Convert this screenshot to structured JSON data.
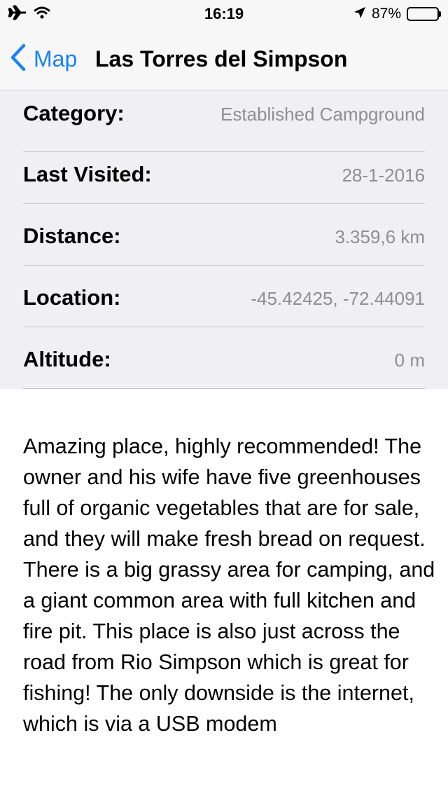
{
  "status_bar": {
    "time": "16:19",
    "battery_percent": "87%",
    "battery_level": 0.87,
    "icons": [
      "airplane-icon",
      "wifi-icon",
      "location-arrow-icon",
      "battery-icon"
    ]
  },
  "nav": {
    "back_label": "Map",
    "title": "Las Torres del Simpson",
    "accent_color": "#1a82fb"
  },
  "details": [
    {
      "label": "Category:",
      "value": "Established Campground"
    },
    {
      "label": "Last Visited:",
      "value": "28-1-2016"
    },
    {
      "label": "Distance:",
      "value": "3.359,6 km"
    },
    {
      "label": "Location:",
      "value": "-45.42425, -72.44091"
    },
    {
      "label": "Altitude:",
      "value": "0 m"
    }
  ],
  "description": "Amazing place, highly recommended! The owner and his wife have five greenhouses full of organic vegetables that are for sale, and they will make fresh bread on request. There is a big grassy area for camping, and a giant common area with full kitchen and fire pit. This place is also just across the road from Rio Simpson which is great for fishing! The only downside is the internet, which is via a USB modem"
}
